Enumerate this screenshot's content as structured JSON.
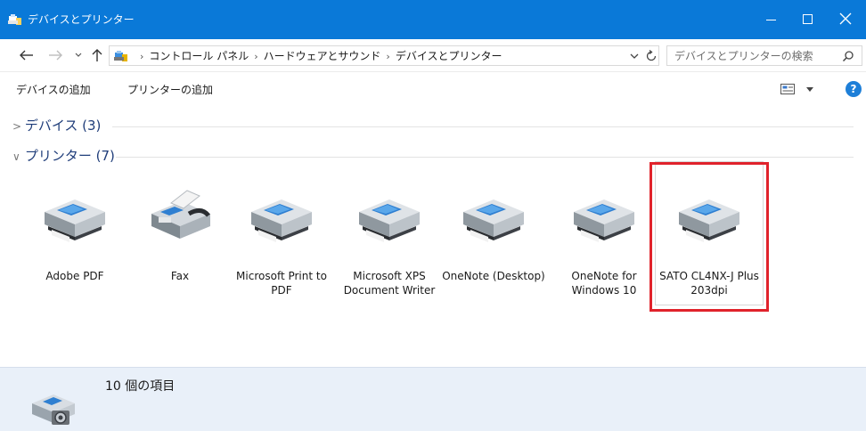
{
  "window": {
    "title": "デバイスとプリンター",
    "accent_color": "#0a79d8"
  },
  "nav": {
    "breadcrumbs": [
      "コントロール パネル",
      "ハードウェアとサウンド",
      "デバイスとプリンター"
    ],
    "search_placeholder": "デバイスとプリンターの検索"
  },
  "commands": {
    "add_device": "デバイスの追加",
    "add_printer": "プリンターの追加",
    "help": "?"
  },
  "groups": {
    "devices": {
      "chevron": ">",
      "label": "デバイス (3)",
      "collapsed": true
    },
    "printers": {
      "chevron": "∨",
      "label": "プリンター (7)",
      "collapsed": false
    }
  },
  "printers": [
    {
      "name": "Adobe PDF",
      "icon": "printer-icon"
    },
    {
      "name": "Fax",
      "icon": "fax-icon"
    },
    {
      "name": "Microsoft Print to PDF",
      "icon": "printer-icon"
    },
    {
      "name": "Microsoft XPS Document Writer",
      "icon": "printer-icon"
    },
    {
      "name": "OneNote (Desktop)",
      "icon": "printer-icon"
    },
    {
      "name": "OneNote for Windows 10",
      "icon": "printer-icon"
    },
    {
      "name": "SATO CL4NX-J Plus 203dpi",
      "icon": "printer-icon",
      "selected": true,
      "highlight_color": "#e0222b"
    }
  ],
  "details": {
    "count_text": "10 個の項目",
    "icon": "devices-printers-icon"
  }
}
